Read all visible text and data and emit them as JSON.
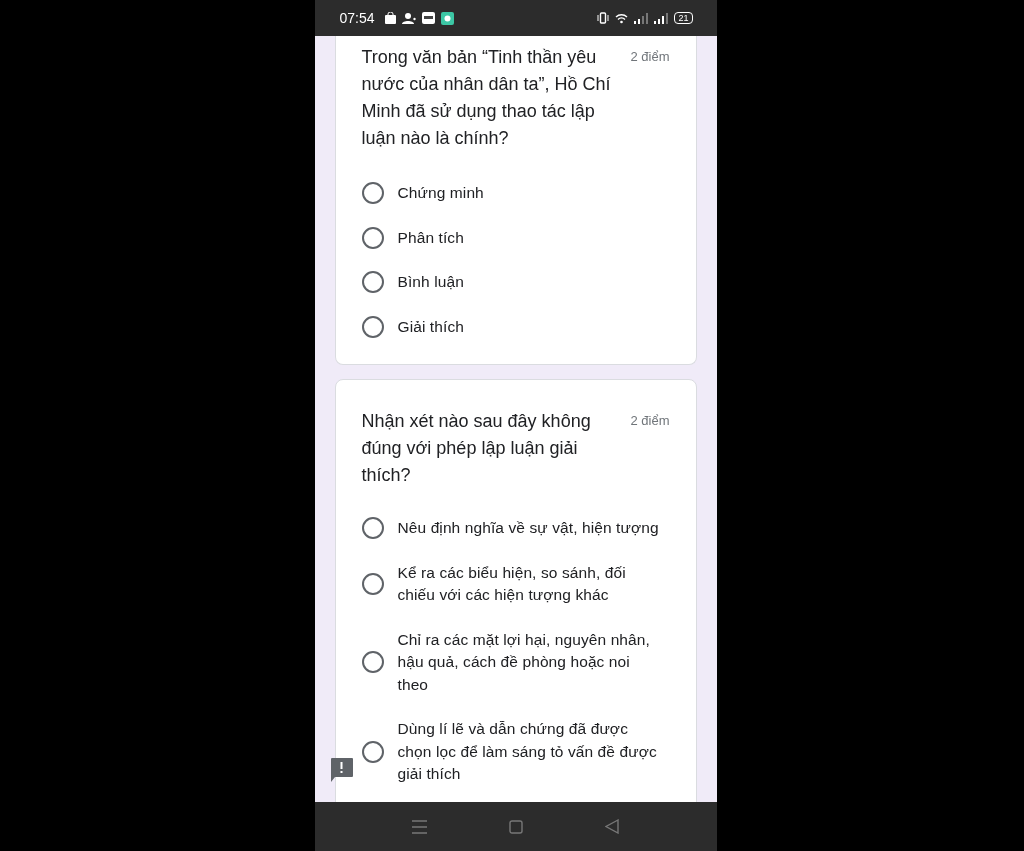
{
  "status_bar": {
    "time": "07:54",
    "battery": "21"
  },
  "questions": [
    {
      "text": "Trong văn bản “Tinh thần yêu nước của nhân dân ta”, Hồ Chí Minh đã sử dụng thao tác lập luận nào là chính?",
      "points": "2 điểm",
      "options": [
        {
          "label": "Chứng minh",
          "selected": false
        },
        {
          "label": "Phân tích",
          "selected": false
        },
        {
          "label": "Bình luận",
          "selected": false
        },
        {
          "label": "Giải thích",
          "selected": false
        }
      ]
    },
    {
      "text": "Nhận xét nào sau đây không đúng với phép lập luận giải thích?",
      "points": "2 điểm",
      "options": [
        {
          "label": "Nêu định nghĩa về sự vật, hiện tượng",
          "selected": false
        },
        {
          "label": "Kể ra các biểu hiện, so sánh, đối chiếu với các hiện tượng khác",
          "selected": false
        },
        {
          "label": "Chỉ ra các mặt lợi hại, nguyên nhân, hậu quả, cách đề phòng hoặc noi theo",
          "selected": false
        },
        {
          "label": "Dùng lí lẽ và dẫn chứng đã được chọn lọc để làm sáng tỏ vấn đề được giải thích",
          "selected": false
        }
      ]
    }
  ]
}
